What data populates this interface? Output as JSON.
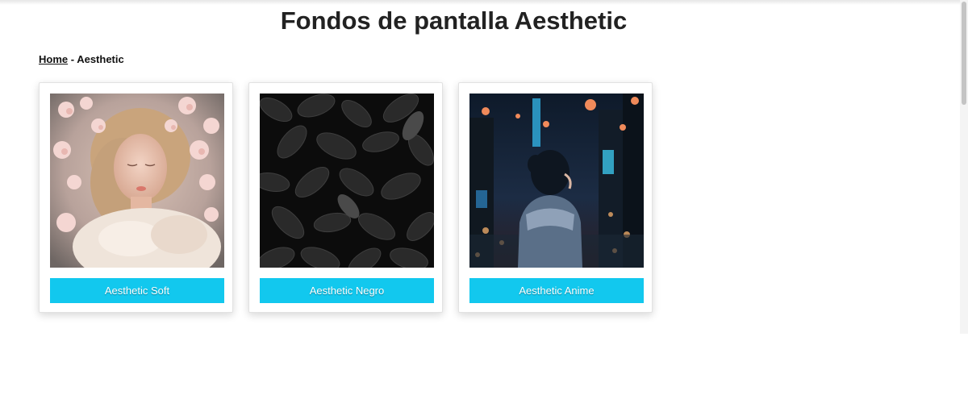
{
  "header": {
    "title": "Fondos de pantalla Aesthetic"
  },
  "breadcrumb": {
    "home": "Home",
    "separator": " - ",
    "current": "Aesthetic"
  },
  "cards": [
    {
      "label": "Aesthetic Soft",
      "image": "girl-with-flowers-photo"
    },
    {
      "label": "Aesthetic Negro",
      "image": "black-leaves-photo"
    },
    {
      "label": "Aesthetic Anime",
      "image": "anime-girl-night-city-photo"
    }
  ],
  "colors": {
    "button": "#12c8ee",
    "button_text": "#ffffff",
    "title": "#222222"
  }
}
